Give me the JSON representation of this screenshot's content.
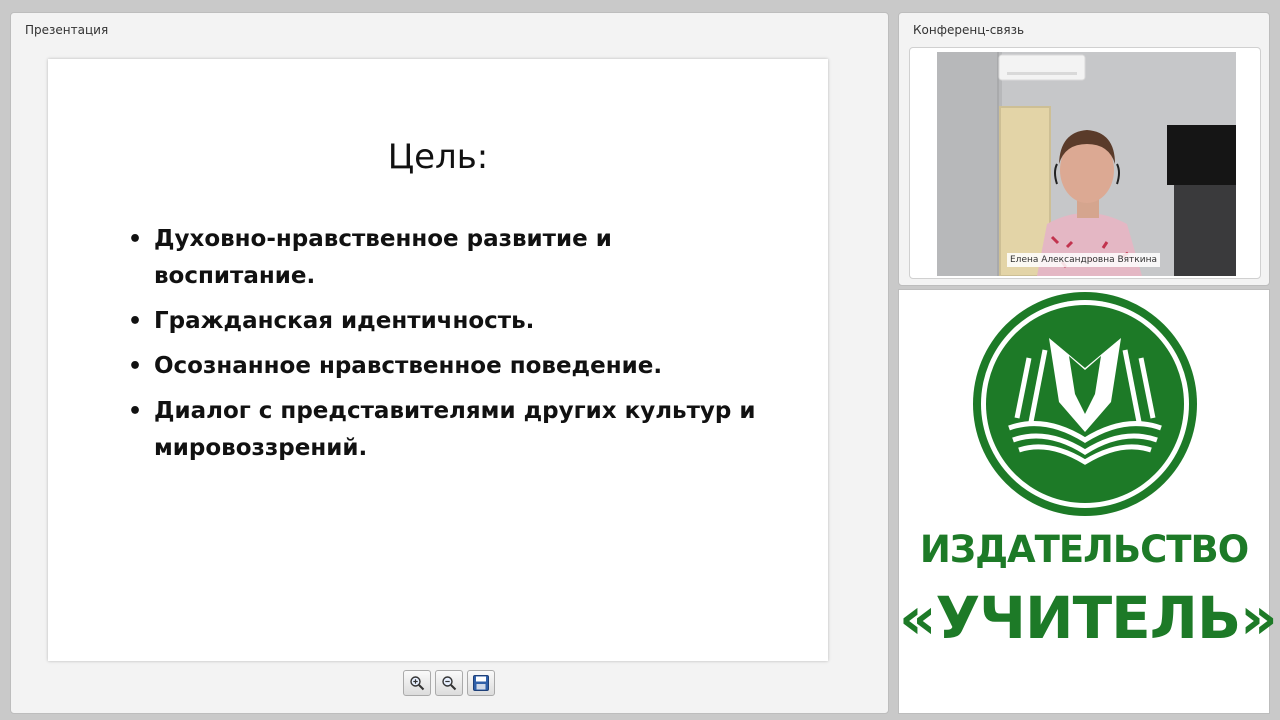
{
  "presentation_panel": {
    "title": "Презентация",
    "slide": {
      "title": "Цель:",
      "bullets": [
        "Духовно-нравственное развитие и воспитание.",
        "Гражданская идентичность.",
        "Осознанное нравственное поведение.",
        "Диалог с представителями других культур и мировоззрений."
      ]
    },
    "toolbar": {
      "buttons": [
        "zoom-in-icon",
        "zoom-out-icon",
        "save-icon"
      ]
    }
  },
  "conference_panel": {
    "title": "Конференц-связь",
    "participant_name": "Елена Александровна Вяткина"
  },
  "logo_panel": {
    "line1": "ИЗДАТЕЛЬСТВО",
    "line2": "«УЧИТЕЛЬ»",
    "brand_color": "#1d7a27"
  }
}
